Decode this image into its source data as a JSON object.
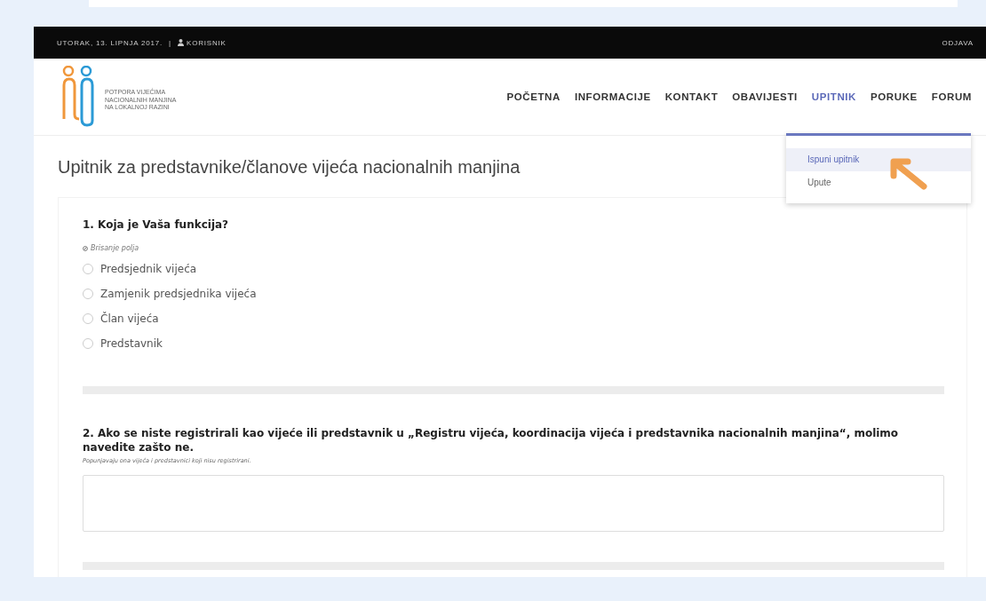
{
  "top_bar": {
    "date": "UTORAK, 13. LIPNJA 2017.",
    "separator": "|",
    "user": "KORISNIK",
    "logout": "ODJAVA"
  },
  "logo": {
    "lines": [
      "POTPORA VIJEĆIMA",
      "NACIONALNIH MANJINA",
      "NA LOKALNOJ RAZINI"
    ]
  },
  "nav": [
    {
      "label": "POČETNA",
      "selected": false
    },
    {
      "label": "INFORMACIJE",
      "selected": false
    },
    {
      "label": "KONTAKT",
      "selected": false
    },
    {
      "label": "OBAVIJESTI",
      "selected": false
    },
    {
      "label": "UPITNIK",
      "selected": true
    },
    {
      "label": "PORUKE",
      "selected": false
    },
    {
      "label": "FORUM",
      "selected": false
    }
  ],
  "dropdown": {
    "items": [
      {
        "label": "Ispuni upitnik",
        "selected": true
      },
      {
        "label": "Upute",
        "selected": false
      }
    ]
  },
  "page_title": "Upitnik za predstavnike/članove vijeća nacionalnih manjina",
  "questions": [
    {
      "kind": "radio",
      "title": "1. Koja je Vaša funkcija?",
      "clear": "Brisanje polja",
      "options": [
        {
          "label": "Predsjednik vijeća",
          "selected": false
        },
        {
          "label": "Zamjenik predsjednika vijeća",
          "selected": false
        },
        {
          "label": "Član vijeća",
          "selected": false
        },
        {
          "label": "Predstavnik",
          "selected": false
        }
      ]
    },
    {
      "kind": "text",
      "title": "2. Ako se niste registrirali kao vijeće ili predstavnik u „Registru vijeća, koordinacija vijeća i predstavnika nacionalnih manjina“, molimo navedite zašto ne.",
      "note": "Popunjavaju ona vijeća i predstavnici koji nisu registrirani."
    }
  ]
}
